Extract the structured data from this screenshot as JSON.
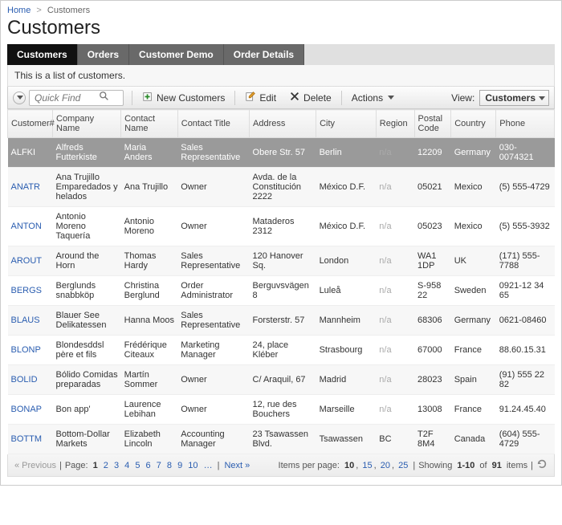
{
  "breadcrumb": {
    "home": "Home",
    "current": "Customers"
  },
  "title": "Customers",
  "tabs": [
    {
      "label": "Customers",
      "active": true
    },
    {
      "label": "Orders",
      "active": false
    },
    {
      "label": "Customer Demo",
      "active": false
    },
    {
      "label": "Order Details",
      "active": false
    }
  ],
  "description": "This is a list of customers.",
  "toolbar": {
    "quickfind_placeholder": "Quick Find",
    "new_label": "New Customers",
    "edit_label": "Edit",
    "delete_label": "Delete",
    "actions_label": "Actions",
    "view_label": "View:",
    "view_value": "Customers"
  },
  "columns": [
    "Customer#",
    "Company Name",
    "Contact Name",
    "Contact Title",
    "Address",
    "City",
    "Region",
    "Postal Code",
    "Country",
    "Phone"
  ],
  "rows": [
    {
      "id": "ALFKI",
      "company": "Alfreds Futterkiste",
      "contact": "Maria Anders",
      "title": "Sales Representative",
      "address": "Obere Str. 57",
      "city": "Berlin",
      "region": "n/a",
      "postal": "12209",
      "country": "Germany",
      "phone": "030-0074321",
      "selected": true
    },
    {
      "id": "ANATR",
      "company": "Ana Trujillo Emparedados y helados",
      "contact": "Ana Trujillo",
      "title": "Owner",
      "address": "Avda. de la Constitución 2222",
      "city": "México D.F.",
      "region": "n/a",
      "postal": "05021",
      "country": "Mexico",
      "phone": "(5) 555-4729"
    },
    {
      "id": "ANTON",
      "company": "Antonio Moreno Taquería",
      "contact": "Antonio Moreno",
      "title": "Owner",
      "address": "Mataderos 2312",
      "city": "México D.F.",
      "region": "n/a",
      "postal": "05023",
      "country": "Mexico",
      "phone": "(5) 555-3932"
    },
    {
      "id": "AROUT",
      "company": "Around the Horn",
      "contact": "Thomas Hardy",
      "title": "Sales Representative",
      "address": "120 Hanover Sq.",
      "city": "London",
      "region": "n/a",
      "postal": "WA1 1DP",
      "country": "UK",
      "phone": "(171) 555-7788"
    },
    {
      "id": "BERGS",
      "company": "Berglunds snabbköp",
      "contact": "Christina Berglund",
      "title": "Order Administrator",
      "address": "Berguvsvägen 8",
      "city": "Luleå",
      "region": "n/a",
      "postal": "S-958 22",
      "country": "Sweden",
      "phone": "0921-12 34 65"
    },
    {
      "id": "BLAUS",
      "company": "Blauer See Delikatessen",
      "contact": "Hanna Moos",
      "title": "Sales Representative",
      "address": "Forsterstr. 57",
      "city": "Mannheim",
      "region": "n/a",
      "postal": "68306",
      "country": "Germany",
      "phone": "0621-08460"
    },
    {
      "id": "BLONP",
      "company": "Blondesddsl père et fils",
      "contact": "Frédérique Citeaux",
      "title": "Marketing Manager",
      "address": "24, place Kléber",
      "city": "Strasbourg",
      "region": "n/a",
      "postal": "67000",
      "country": "France",
      "phone": "88.60.15.31"
    },
    {
      "id": "BOLID",
      "company": "Bólido Comidas preparadas",
      "contact": "Martín Sommer",
      "title": "Owner",
      "address": "C/ Araquil, 67",
      "city": "Madrid",
      "region": "n/a",
      "postal": "28023",
      "country": "Spain",
      "phone": "(91) 555 22 82"
    },
    {
      "id": "BONAP",
      "company": "Bon app'",
      "contact": "Laurence Lebihan",
      "title": "Owner",
      "address": "12, rue des Bouchers",
      "city": "Marseille",
      "region": "n/a",
      "postal": "13008",
      "country": "France",
      "phone": "91.24.45.40"
    },
    {
      "id": "BOTTM",
      "company": "Bottom-Dollar Markets",
      "contact": "Elizabeth Lincoln",
      "title": "Accounting Manager",
      "address": "23 Tsawassen Blvd.",
      "city": "Tsawassen",
      "region": "BC",
      "postal": "T2F 8M4",
      "country": "Canada",
      "phone": "(604) 555-4729"
    }
  ],
  "pager": {
    "previous": "« Previous",
    "page_label": "Page:",
    "pages": [
      "1",
      "2",
      "3",
      "4",
      "5",
      "6",
      "7",
      "8",
      "9",
      "10",
      "…"
    ],
    "current_page": "1",
    "next": "Next »",
    "ipp_label": "Items per page:",
    "ipp_options": [
      "10",
      "15",
      "20",
      "25"
    ],
    "ipp_current": "10",
    "showing_prefix": "Showing",
    "showing_range": "1-10",
    "showing_of": "of",
    "showing_total": "91",
    "showing_items": "items"
  }
}
